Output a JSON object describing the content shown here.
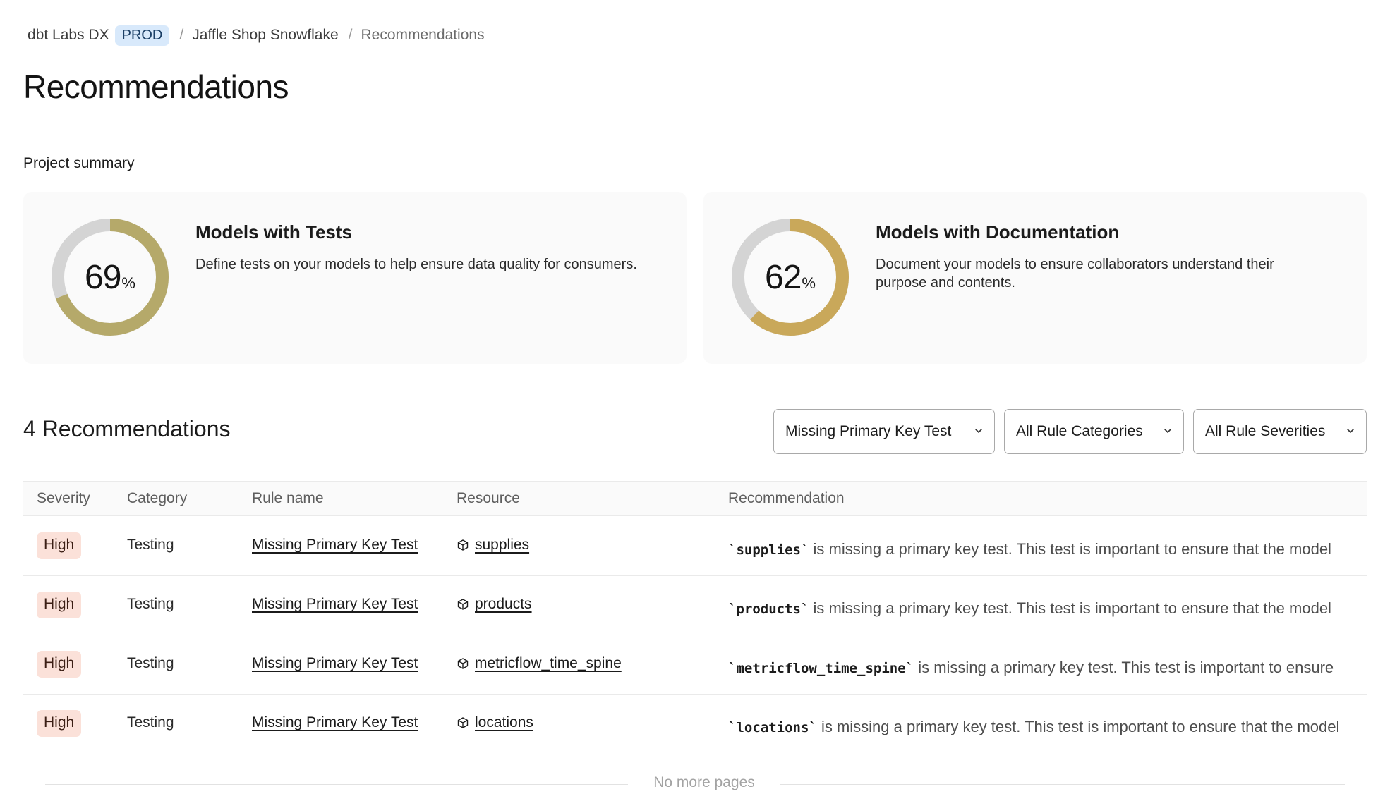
{
  "breadcrumb": {
    "account": "dbt Labs DX",
    "environment": "PROD",
    "project": "Jaffle Shop Snowflake",
    "current": "Recommendations",
    "separator": "/"
  },
  "page_title": "Recommendations",
  "summary": {
    "label": "Project summary",
    "cards": [
      {
        "value": "69",
        "unit": "%",
        "progress": 0.69,
        "color": "#b5a96a",
        "title": "Models with Tests",
        "description": "Define tests on your models to help ensure data quality for consumers."
      },
      {
        "value": "62",
        "unit": "%",
        "progress": 0.62,
        "color": "#c9a85a",
        "title": "Models with Documentation",
        "description": "Document your models to ensure collaborators understand their purpose and contents."
      }
    ],
    "track_color": "#d4d4d4"
  },
  "recommendations": {
    "heading": "4 Recommendations",
    "filters": {
      "rule": "Missing Primary Key Test",
      "category": "All Rule Categories",
      "severity": "All Rule Severities"
    },
    "columns": {
      "severity": "Severity",
      "category": "Category",
      "rule_name": "Rule name",
      "resource": "Resource",
      "recommendation": "Recommendation"
    },
    "rows": [
      {
        "severity": "High",
        "category": "Testing",
        "rule_name": "Missing Primary Key Test",
        "resource": "supplies",
        "code": "`supplies`",
        "text": " is missing a primary key test. This test is important to ensure that the model"
      },
      {
        "severity": "High",
        "category": "Testing",
        "rule_name": "Missing Primary Key Test",
        "resource": "products",
        "code": "`products`",
        "text": " is missing a primary key test. This test is important to ensure that the model"
      },
      {
        "severity": "High",
        "category": "Testing",
        "rule_name": "Missing Primary Key Test",
        "resource": "metricflow_time_spine",
        "code": "`metricflow_time_spine`",
        "text": " is missing a primary key test. This test is important to ensure"
      },
      {
        "severity": "High",
        "category": "Testing",
        "rule_name": "Missing Primary Key Test",
        "resource": "locations",
        "code": "`locations`",
        "text": " is missing a primary key test. This test is important to ensure that the model"
      }
    ],
    "severity_color": "#fbe1d9",
    "footer": "No more pages"
  }
}
